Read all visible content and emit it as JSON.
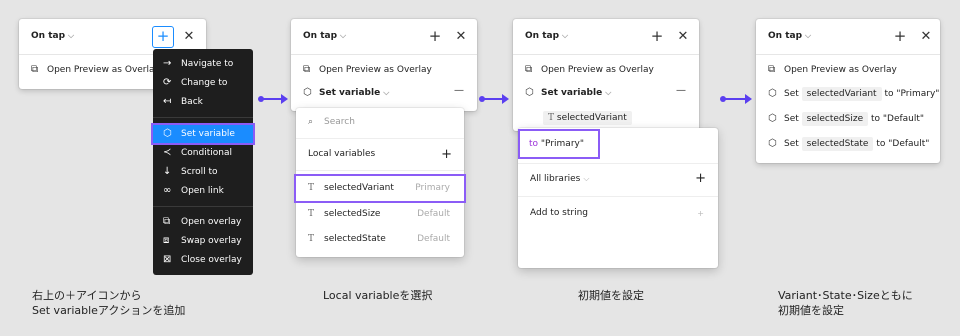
{
  "panel1": {
    "title": "On tap",
    "plus": "+",
    "close": "✕",
    "action": "Open Preview as Overlay"
  },
  "action_menu": {
    "items": [
      {
        "icon": "arrow-right-icon",
        "label": "Navigate to"
      },
      {
        "icon": "swap-icon",
        "label": "Change to"
      },
      {
        "icon": "back-icon",
        "label": "Back"
      },
      {
        "icon": "set-variable-icon",
        "label": "Set variable",
        "selected": true
      },
      {
        "icon": "conditional-icon",
        "label": "Conditional"
      },
      {
        "icon": "scroll-icon",
        "label": "Scroll to"
      },
      {
        "icon": "link-icon",
        "label": "Open link"
      },
      {
        "icon": "open-overlay-icon",
        "label": "Open overlay"
      },
      {
        "icon": "swap-overlay-icon",
        "label": "Swap overlay"
      },
      {
        "icon": "close-overlay-icon",
        "label": "Close overlay"
      }
    ]
  },
  "panel2": {
    "title": "On tap",
    "action": "Open Preview as Overlay",
    "set_variable": "Set variable",
    "minus": "—",
    "search_placeholder": "Search",
    "local_variables": "Local variables",
    "variables": [
      {
        "name": "selectedVariant",
        "hint": "Primary"
      },
      {
        "name": "selectedSize",
        "hint": "Default"
      },
      {
        "name": "selectedState",
        "hint": "Default"
      }
    ]
  },
  "panel3": {
    "title": "On tap",
    "action": "Open Preview as Overlay",
    "set_variable": "Set variable",
    "chip": "selectedVariant",
    "to_label": "to",
    "to_value": "\"Primary\"",
    "all_libraries": "All libraries",
    "add_to_string": "Add to string"
  },
  "panel4": {
    "title": "On tap",
    "action": "Open Preview as Overlay",
    "rows": [
      {
        "set": "Set",
        "var": "selectedVariant",
        "to": "to \"Primary\""
      },
      {
        "set": "Set",
        "var": "selectedSize",
        "to": "to \"Default\""
      },
      {
        "set": "Set",
        "var": "selectedState",
        "to": "to \"Default\""
      }
    ]
  },
  "captions": {
    "c1_line1": "右上の＋アイコンから",
    "c1_line2": "Set variableアクションを追加",
    "c2": "Local variableを選択",
    "c3": "初期値を設定",
    "c4_line1": "Variant･State･Sizeともに",
    "c4_line2": "初期値を設定"
  },
  "colors": {
    "accent": "#1a8cff",
    "highlight": "#8b5cf6",
    "arrow": "#5b3ff0",
    "to_text": "#9b30d9"
  }
}
